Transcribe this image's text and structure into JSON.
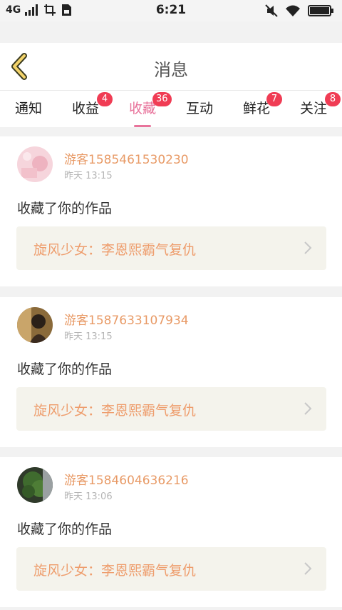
{
  "status_bar": {
    "network": "4G",
    "time": "6:21"
  },
  "header": {
    "title": "消息"
  },
  "tabs": [
    {
      "label": "通知",
      "badge": ""
    },
    {
      "label": "收益",
      "badge": "4"
    },
    {
      "label": "收藏",
      "badge": "36",
      "active": true
    },
    {
      "label": "互动",
      "badge": ""
    },
    {
      "label": "鲜花",
      "badge": "7"
    },
    {
      "label": "关注",
      "badge": "8"
    }
  ],
  "colors": {
    "accent": "#e8739b",
    "badge": "#f03c54",
    "username": "#e89a66",
    "work_title": "#ee9d6d",
    "work_bg": "#f4f3ec"
  },
  "items": [
    {
      "username": "游客1585461530230",
      "time": "昨天 13:15",
      "action": "收藏了你的作品",
      "work_title": "旋风少女：李恩熙霸气复仇"
    },
    {
      "username": "游客1587633107934",
      "time": "昨天 13:15",
      "action": "收藏了你的作品",
      "work_title": "旋风少女：李恩熙霸气复仇"
    },
    {
      "username": "游客1584604636216",
      "time": "昨天 13:06",
      "action": "收藏了你的作品",
      "work_title": "旋风少女：李恩熙霸气复仇"
    }
  ]
}
